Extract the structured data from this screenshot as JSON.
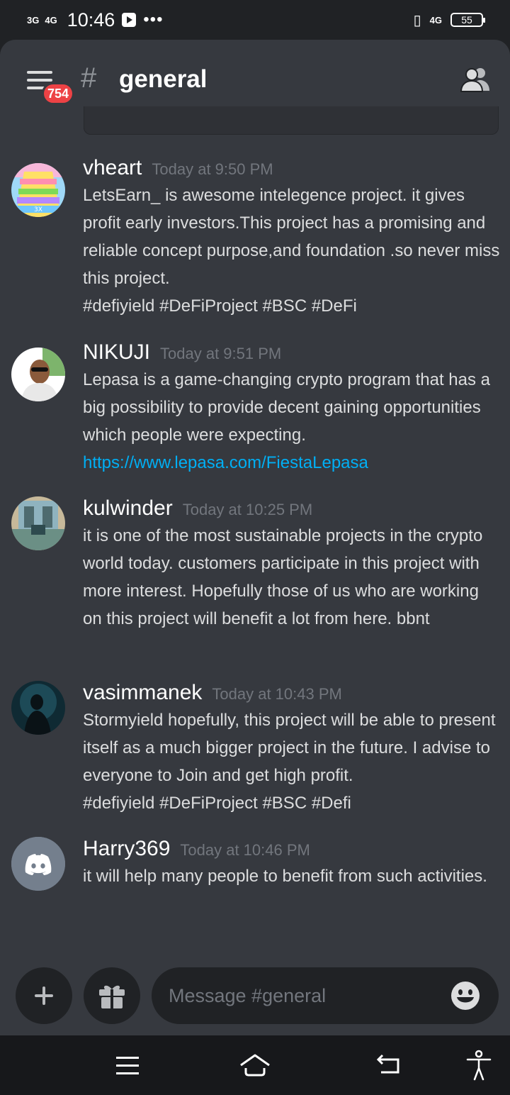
{
  "status_bar": {
    "signal_1": "3G",
    "signal_2": "4G",
    "time": "10:46",
    "network": "4G",
    "battery": "55"
  },
  "header": {
    "hash_symbol": "#",
    "channel_name": "general",
    "badge_count": "754"
  },
  "messages": [
    {
      "username": "vheart",
      "timestamp": "Today at 9:50 PM",
      "text": "LetsEarn_  is awesome intelegence project. it gives profit early investors.This project has a promising and reliable concept purpose,and foundation .so never miss this project.",
      "text2": "#defiyield #DeFiProject #BSC #DeFi"
    },
    {
      "username": "NIKUJI",
      "timestamp": "Today at 9:51 PM",
      "text": "Lepasa is a game-changing crypto program that has a big possibility to provide decent gaining opportunities which people were expecting.",
      "link": "https://www.lepasa.com/FiestaLepasa"
    },
    {
      "username": "kulwinder",
      "timestamp": "Today at 10:25 PM",
      "text": "it is one of the most sustainable projects in the crypto world today. customers participate in this project with more interest. Hopefully those of us who are working on this project will benefit a lot from here. bbnt"
    },
    {
      "username": "vasimmanek",
      "timestamp": "Today at 10:43 PM",
      "text": "Stormyield hopefully, this project will be able to present itself as a much bigger project in the future. I advise to everyone to Join and get high profit.",
      "text2": "#defiyield #DeFiProject #BSC #Defi"
    },
    {
      "username": "Harry369",
      "timestamp": "Today at 10:46 PM",
      "text": "it will help many people to benefit from such activities."
    }
  ],
  "input": {
    "placeholder": "Message #general"
  },
  "icons": {
    "add": "plus-icon",
    "gift": "gift-icon",
    "emoji": "emoji-icon",
    "members": "members-icon",
    "menu": "hamburger-icon"
  },
  "colors": {
    "background": "#36393f",
    "header": "#202225",
    "link": "#00aff4",
    "badge": "#ed4245",
    "discord_blurple": "#5865f2"
  }
}
